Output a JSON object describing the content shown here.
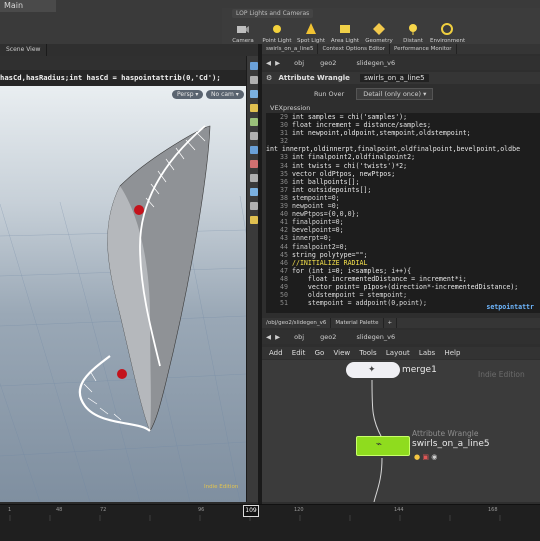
{
  "topbar": {
    "main_label": "Main",
    "shelf_title": "LOP Lights and Cameras",
    "tools": [
      {
        "label": "Camera",
        "icon": "camera-icon"
      },
      {
        "label": "Point Light",
        "icon": "point-light-icon"
      },
      {
        "label": "Spot Light",
        "icon": "spot-light-icon"
      },
      {
        "label": "Area Light",
        "icon": "area-light-icon"
      },
      {
        "label": "Geometry Light",
        "icon": "geometry-light-icon"
      },
      {
        "label": "Distant Light",
        "icon": "distant-light-icon"
      },
      {
        "label": "Environment Light",
        "icon": "environment-light-icon"
      }
    ]
  },
  "viewport": {
    "expression": "hasCd,hasRadius;int hasCd = haspointattrib(0,'Cd');",
    "persp_label": "Persp",
    "cam_label": "No cam",
    "indie_label": "Indie Edition",
    "colors": {
      "geo": "#8f9296",
      "handles": "#ffffff",
      "points": "#c4121b"
    }
  },
  "right_tabs": [
    "swirls_on_a_line5",
    "Context Options Editor",
    "Performance Monitor"
  ],
  "pathbar": {
    "obj": "obj",
    "geo": "geo2",
    "node": "slidegen_v6"
  },
  "wrangle": {
    "type": "Attribute Wrangle",
    "name": "swirls_on_a_line5",
    "run_over_label": "Run Over",
    "run_over_value": "Detail (only once)",
    "vex_label": "VEXpression",
    "lines": [
      {
        "n": "29",
        "t": "int samples = chi('samples');"
      },
      {
        "n": "30",
        "t": "float increment = distance/samples;"
      },
      {
        "n": "31",
        "t": "int newpoint,oldpoint,stempoint,oldstempoint;"
      },
      {
        "n": "32",
        "t": "int innerpt,oldinnerpt,finalpoint,oldfinalpoint,bevelpoint,oldbe"
      },
      {
        "n": "33",
        "t": "int finalpoint2,oldfinalpoint2;"
      },
      {
        "n": "34",
        "t": "int twists = chi('twists')*2;"
      },
      {
        "n": "35",
        "t": "vector oldPtpos, newPtpos;"
      },
      {
        "n": "36",
        "t": "int ballpoints[];"
      },
      {
        "n": "37",
        "t": "int outsidepoints[];"
      },
      {
        "n": "38",
        "t": "stempoint=0;"
      },
      {
        "n": "39",
        "t": "newpoint =0;"
      },
      {
        "n": "40",
        "t": "newPtpos={0,0,0};"
      },
      {
        "n": "41",
        "t": "finalpoint=0;"
      },
      {
        "n": "42",
        "t": "bevelpoint=0;"
      },
      {
        "n": "43",
        "t": "innerpt=0;"
      },
      {
        "n": "44",
        "t": "finalpoint2=0;"
      },
      {
        "n": "45",
        "t": "string polytype=\"\";"
      },
      {
        "n": "46",
        "t": "//INITIALIZE RADIAL"
      },
      {
        "n": "47",
        "t": "for (int i=0; i<samples; i++){"
      },
      {
        "n": "48",
        "t": "    float incrementedDistance = increment*i;"
      },
      {
        "n": "49",
        "t": "    vector point= p1pos+(direction*-incrementedDistance);"
      },
      {
        "n": "50",
        "t": "    oldstempoint = stempoint;"
      },
      {
        "n": "51",
        "t": "    stempoint = addpoint(0,point);"
      }
    ],
    "code_footer": "setpointattr"
  },
  "network": {
    "tabs": [
      "/obj/geo2/slidegen_v6",
      "Material Palette"
    ],
    "menu": [
      "Add",
      "Edit",
      "Go",
      "View",
      "Tools",
      "Layout",
      "Labs",
      "Help"
    ],
    "merge_label": "merge1",
    "node_type": "Attribute Wrangle",
    "node_name": "swirls_on_a_line5",
    "indie_label": "Indie Edition"
  },
  "timeline": {
    "ticks": [
      "1",
      "48",
      "72",
      "96",
      "120",
      "144",
      "168"
    ],
    "current_frame": "109"
  }
}
